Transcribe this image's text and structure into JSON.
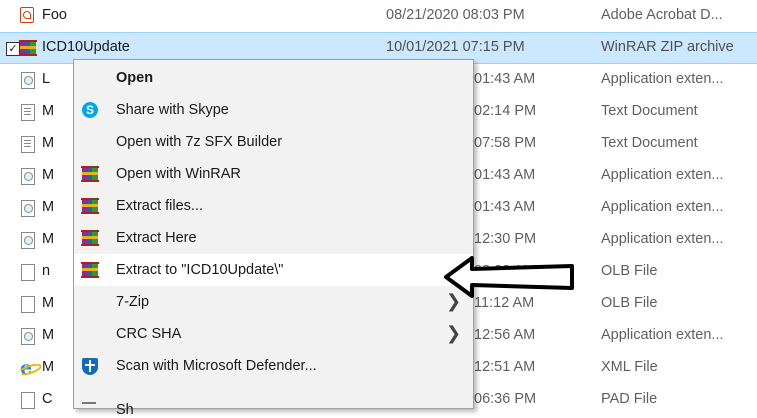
{
  "files": [
    {
      "name": "Foo",
      "date": "08/21/2020 08:03 PM",
      "type": "Adobe Acrobat D...",
      "icon": "pdf-icon"
    },
    {
      "name": "ICD10Update",
      "date": "10/01/2021 07:15 PM",
      "type": "WinRAR ZIP archive",
      "icon": "winrar-icon",
      "selected": true
    },
    {
      "name": "L",
      "date": "01:43 AM",
      "type": "Application exten...",
      "icon": "dll-icon"
    },
    {
      "name": "M",
      "date": "02:14 PM",
      "type": "Text Document",
      "icon": "text-document-icon"
    },
    {
      "name": "M",
      "date": "07:58 PM",
      "type": "Text Document",
      "icon": "text-document-icon"
    },
    {
      "name": "M",
      "date": "01:43 AM",
      "type": "Application exten...",
      "icon": "dll-icon"
    },
    {
      "name": "M",
      "date": "01:43 AM",
      "type": "Application exten...",
      "icon": "dll-icon"
    },
    {
      "name": "M",
      "date": "12:30 PM",
      "type": "Application exten...",
      "icon": "dll-icon"
    },
    {
      "name": "n",
      "date": "08:23 AM",
      "type": "OLB File",
      "icon": "blank-file-icon"
    },
    {
      "name": "M",
      "date": "11:12 AM",
      "type": "OLB File",
      "icon": "blank-file-icon"
    },
    {
      "name": "M",
      "date": "12:56 AM",
      "type": "Application exten...",
      "icon": "dll-icon"
    },
    {
      "name": "M",
      "date": "12:51 AM",
      "type": "XML File",
      "icon": "internet-explorer-icon"
    },
    {
      "name": "C",
      "date": "06:36 PM",
      "type": "PAD File",
      "icon": "blank-file-icon"
    }
  ],
  "menu": {
    "items": [
      {
        "label": "Open",
        "icon": "",
        "bold": true
      },
      {
        "label": "Share with Skype",
        "icon": "skype-icon"
      },
      {
        "label": "Open with 7z SFX Builder",
        "icon": ""
      },
      {
        "label": "Open with WinRAR",
        "icon": "winrar-icon"
      },
      {
        "label": "Extract files...",
        "icon": "winrar-icon"
      },
      {
        "label": "Extract Here",
        "icon": "winrar-icon"
      },
      {
        "label": "Extract to \"ICD10Update\\\"",
        "icon": "winrar-icon",
        "highlighted": true
      },
      {
        "label": "7-Zip",
        "icon": "",
        "submenu": true
      },
      {
        "label": "CRC SHA",
        "icon": "",
        "submenu": true
      },
      {
        "label": "Scan with Microsoft Defender...",
        "icon": "defender-shield-icon"
      },
      {
        "label": "Sh",
        "icon": "share-icon"
      }
    ]
  },
  "colors": {
    "selection": "#cce8ff",
    "menu_background": "#f2f2f2",
    "menu_highlight": "#ffffff"
  }
}
